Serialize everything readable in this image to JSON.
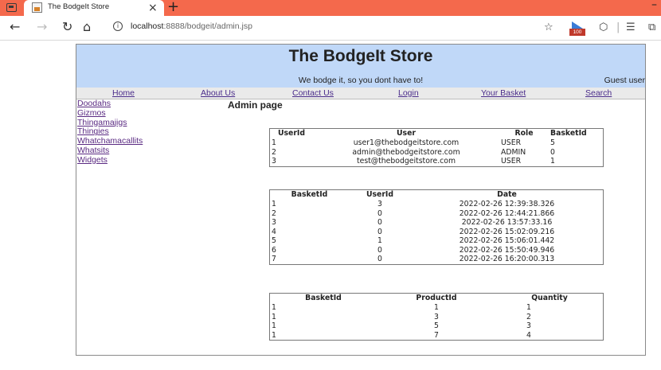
{
  "browser": {
    "tab_title": "The BodgeIt Store",
    "tab_close": "×",
    "new_tab": "+",
    "url_host": "localhost",
    "url_rest": ":8888/bodgeit/admin.jsp",
    "extension_badge": "100",
    "icons": [
      "back-icon",
      "forward-icon",
      "reload-icon",
      "home-icon",
      "info-icon",
      "favorites-icon",
      "extension-icon",
      "collections-icon",
      "reading-list-icon"
    ]
  },
  "site": {
    "title": "The BodgeIt Store",
    "tagline": "We bodge it, so you dont have to!",
    "user_status": "Guest user"
  },
  "nav": {
    "home": "Home",
    "about": "About Us",
    "contact": "Contact Us",
    "login": "Login",
    "basket": "Your Basket",
    "search": "Search"
  },
  "sidebar": {
    "items": [
      {
        "label": "Doodahs"
      },
      {
        "label": "Gizmos"
      },
      {
        "label": "Thingamajigs"
      },
      {
        "label": "Thingies"
      },
      {
        "label": "Whatchamacallits"
      },
      {
        "label": "Whatsits"
      },
      {
        "label": "Widgets"
      }
    ]
  },
  "main": {
    "title": "Admin page"
  },
  "users_table": {
    "headers": [
      "UserId",
      "User",
      "Role",
      "BasketId"
    ],
    "rows": [
      [
        "1",
        "user1@thebodgeitstore.com",
        "USER",
        "5"
      ],
      [
        "2",
        "admin@thebodgeitstore.com",
        "ADMIN",
        "0"
      ],
      [
        "3",
        "test@thebodgeitstore.com",
        "USER",
        "1"
      ]
    ]
  },
  "baskets_table": {
    "headers": [
      "BasketId",
      "UserId",
      "Date"
    ],
    "rows": [
      [
        "1",
        "3",
        "2022-02-26 12:39:38.326"
      ],
      [
        "2",
        "0",
        "2022-02-26 12:44:21.866"
      ],
      [
        "3",
        "0",
        "2022-02-26 13:57:33.16"
      ],
      [
        "4",
        "0",
        "2022-02-26 15:02:09.216"
      ],
      [
        "5",
        "1",
        "2022-02-26 15:06:01.442"
      ],
      [
        "6",
        "0",
        "2022-02-26 15:50:49.946"
      ],
      [
        "7",
        "0",
        "2022-02-26 16:20:00.313"
      ]
    ]
  },
  "contents_table": {
    "headers": [
      "BasketId",
      "ProductId",
      "Quantity"
    ],
    "rows": [
      [
        "1",
        "1",
        "1"
      ],
      [
        "1",
        "3",
        "2"
      ],
      [
        "1",
        "5",
        "3"
      ],
      [
        "1",
        "7",
        "4"
      ]
    ]
  },
  "colors": {
    "tab_bar": "#f4694c",
    "header_bg": "#c0d8f8",
    "link": "#5a2a82"
  }
}
